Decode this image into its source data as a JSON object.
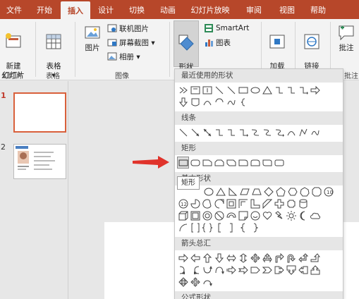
{
  "tabs": [
    {
      "label": "文件",
      "active": false
    },
    {
      "label": "开始",
      "active": false
    },
    {
      "label": "插入",
      "active": true
    },
    {
      "label": "设计",
      "active": false
    },
    {
      "label": "切换",
      "active": false
    },
    {
      "label": "动画",
      "active": false
    },
    {
      "label": "幻灯片放映",
      "active": false
    },
    {
      "label": "审阅",
      "active": false
    },
    {
      "label": "视图",
      "active": false
    },
    {
      "label": "帮助",
      "active": false
    }
  ],
  "ribbon": {
    "new_slide": "新建\n幻灯片 ▾",
    "table": "表格\n▾",
    "picture": "图片",
    "online_picture": "联机图片",
    "screenshot": "屏幕截图 ▾",
    "album": "相册 ▾",
    "shapes": "形状\n▾",
    "smartart": "SmartArt",
    "chart": "图表",
    "addins": "加载\n项 ▾",
    "link": "链接\n▾",
    "comment": "批注",
    "group_slides": "幻灯片",
    "group_table": "表格",
    "group_images": "图像",
    "group_comments": "批注"
  },
  "slides": [
    {
      "number": "1"
    },
    {
      "number": "2"
    }
  ],
  "shapes_menu": {
    "sections": [
      "最近使用的形状",
      "线条",
      "矩形",
      "基本形状",
      "箭头总汇",
      "公式形状"
    ],
    "tooltip": "矩形"
  },
  "colors": {
    "accent": "#b7472a",
    "selection": "#d9603b",
    "arrow": "#e0332b"
  }
}
